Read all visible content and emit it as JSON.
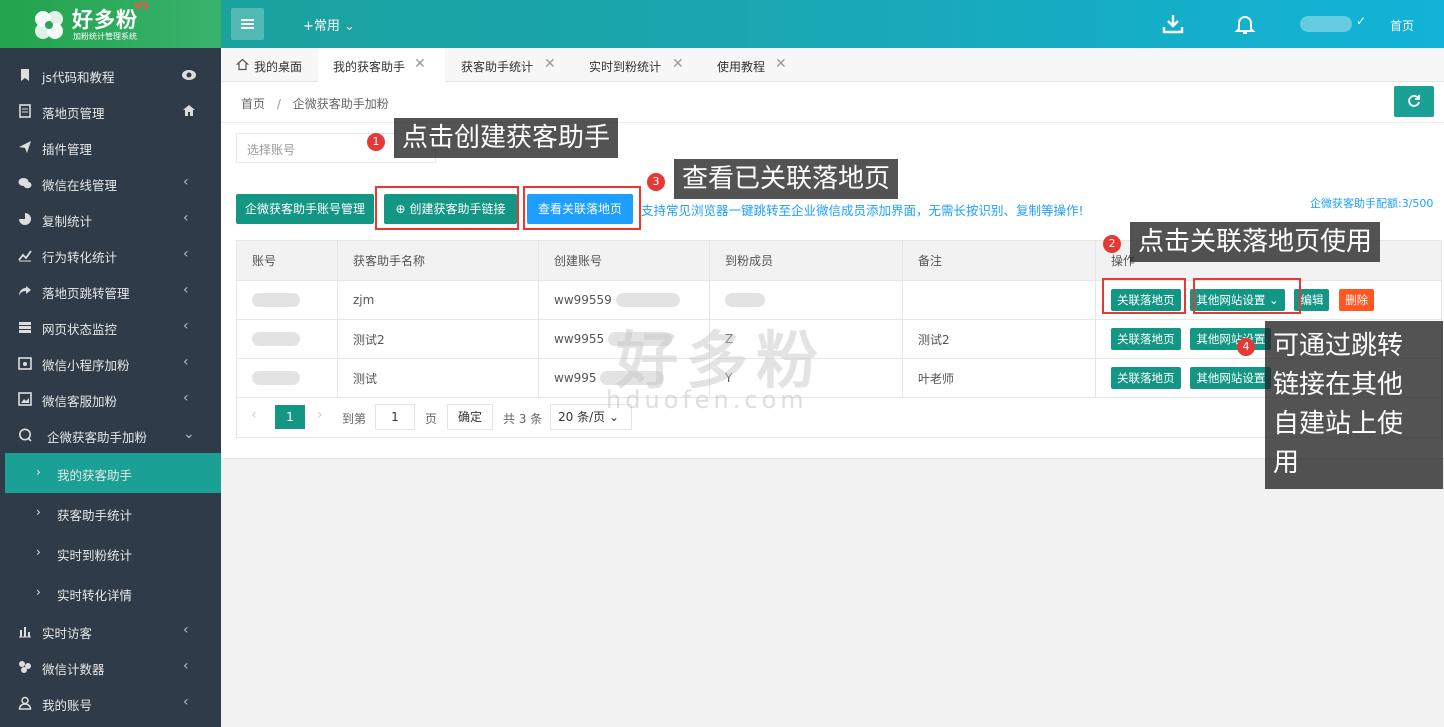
{
  "brand": {
    "title": "好多粉",
    "version": "V5",
    "subtitle": "加粉统计管理系统"
  },
  "topbar": {
    "common_menu": "+常用",
    "home": "首页"
  },
  "sidebar": {
    "items": [
      {
        "label": "js代码和教程",
        "icon": "bookmark-icon"
      },
      {
        "label": "落地页管理",
        "icon": "document-icon"
      },
      {
        "label": "插件管理",
        "icon": "paper-plane-icon"
      },
      {
        "label": "微信在线管理",
        "icon": "wechat-icon"
      },
      {
        "label": "复制统计",
        "icon": "pie-chart-icon"
      },
      {
        "label": "行为转化统计",
        "icon": "line-chart-icon"
      },
      {
        "label": "落地页跳转管理",
        "icon": "share-icon"
      },
      {
        "label": "网页状态监控",
        "icon": "server-icon"
      },
      {
        "label": "微信小程序加粉",
        "icon": "calendar-icon"
      },
      {
        "label": "微信客服加粉",
        "icon": "image-icon"
      },
      {
        "label": "企微获客助手加粉",
        "icon": "chat-icon"
      }
    ],
    "sub_items": [
      {
        "label": "我的获客助手"
      },
      {
        "label": "获客助手统计"
      },
      {
        "label": "实时到粉统计"
      },
      {
        "label": "实时转化详情"
      }
    ],
    "bottom_items": [
      {
        "label": "实时访客",
        "icon": "bar-chart-icon"
      },
      {
        "label": "微信计数器",
        "icon": "counter-icon"
      },
      {
        "label": "我的账号",
        "icon": "user-icon"
      }
    ]
  },
  "tabs": [
    {
      "label": "我的桌面"
    },
    {
      "label": "我的获客助手"
    },
    {
      "label": "获客助手统计"
    },
    {
      "label": "实时到粉统计"
    },
    {
      "label": "使用教程"
    }
  ],
  "breadcrumb": {
    "home": "首页",
    "current": "企微获客助手加粉"
  },
  "filter": {
    "account_placeholder": "选择账号"
  },
  "toolbar": {
    "manage_accounts": "企微获客助手账号管理",
    "create_link": "创建获客助手链接",
    "view_linked": "查看关联落地页",
    "tip": "支持常见浏览器一键跳转至企业微信成员添加界面，无需长按识别、复制等操作!",
    "quota": "企微获客助手配额:3/500"
  },
  "table": {
    "headers": [
      "账号",
      "获客助手名称",
      "创建账号",
      "到粉成员",
      "备注",
      "操作"
    ],
    "rows": [
      {
        "name": "zjm",
        "creator": "ww99559",
        "member": "",
        "note": ""
      },
      {
        "name": "测试2",
        "creator": "ww9955",
        "member": "Z",
        "note": "测试2"
      },
      {
        "name": "测试",
        "creator": "ww995",
        "member": "Y",
        "note": "叶老师"
      }
    ],
    "actions": {
      "link_page": "关联落地页",
      "other_site": "其他网站设置",
      "edit": "编辑",
      "delete": "删除"
    }
  },
  "pager": {
    "current": "1",
    "goto_label": "到第",
    "goto_value": "1",
    "page_unit": "页",
    "confirm": "确定",
    "total": "共 3 条",
    "page_size": "20 条/页"
  },
  "annotations": {
    "a1": {
      "num": "1",
      "text": "点击创建获客助手"
    },
    "a2": {
      "num": "2",
      "text": "点击关联落地页使用"
    },
    "a3": {
      "num": "3",
      "text": "查看已关联落地页"
    },
    "a4": {
      "num": "4",
      "text_lines": [
        "可通过跳转",
        "链接在其他",
        "自建站上使",
        "用"
      ]
    }
  },
  "watermark": {
    "main": "好多粉",
    "sub": "hduofen.com"
  },
  "colors": {
    "primary": "#139684",
    "blue": "#1e9fff",
    "danger": "#ff5722",
    "sidebar": "#2f3b49",
    "annotation": "#e53935"
  }
}
